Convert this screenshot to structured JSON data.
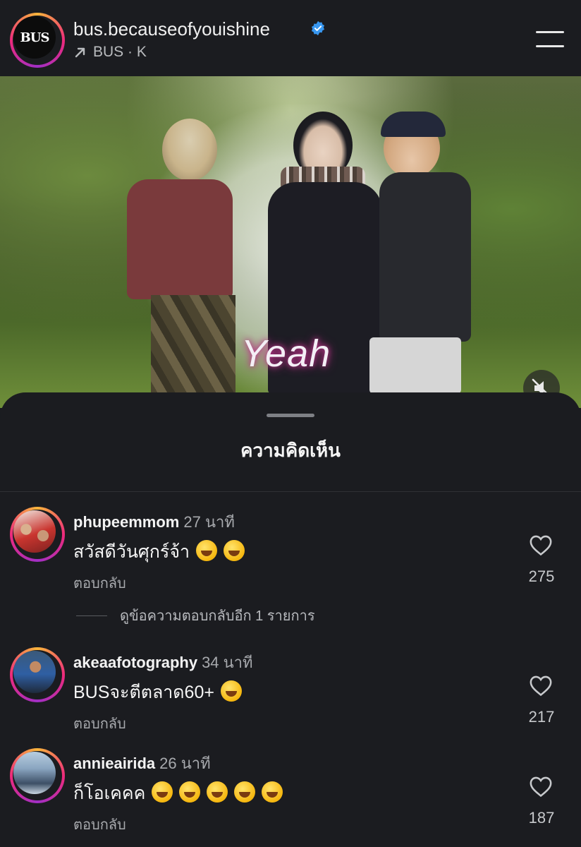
{
  "header": {
    "logo_text": "BUS",
    "account_name": "bus.becauseofyouishine",
    "audio_label": "BUS · K",
    "icons": [
      "arrow-up-right-icon",
      "verified-badge-icon",
      "menu-icon"
    ]
  },
  "video": {
    "overlay_text": "Yeah",
    "icons": [
      "speaker-muted-icon"
    ]
  },
  "comments_sheet": {
    "title": "ความคิดเห็น",
    "view_replies": "ดูข้อความตอบกลับอีก 1 รายการ",
    "comments": [
      {
        "username": "phupeemmom",
        "time": "27 นาที",
        "text": "สวัสดีวันศุกร์จ้า",
        "emojis": [
          "laughing-emoji",
          "grinning-emoji"
        ],
        "reply_label": "ตอบกลับ",
        "likes": "275"
      },
      {
        "username": "akeaafotography",
        "time": "34 นาที",
        "text": "BUSจะตีตลาด60+",
        "emojis": [
          "grinning-emoji"
        ],
        "reply_label": "ตอบกลับ",
        "likes": "217"
      },
      {
        "username": "annieairida",
        "time": "26 นาที",
        "text": "ก็โอเคคค",
        "emojis": [
          "joy-emoji",
          "rofl-emoji",
          "joy-emoji",
          "rofl-emoji",
          "joy-emoji"
        ],
        "reply_label": "ตอบกลับ",
        "likes": "187"
      }
    ]
  },
  "colors": {
    "background": "#1b1c20",
    "story_ring": [
      "#f8b53b",
      "#ee2a7b",
      "#a12fc6"
    ],
    "verified": "#3897f0",
    "secondary_text": "#a7a9ad"
  }
}
